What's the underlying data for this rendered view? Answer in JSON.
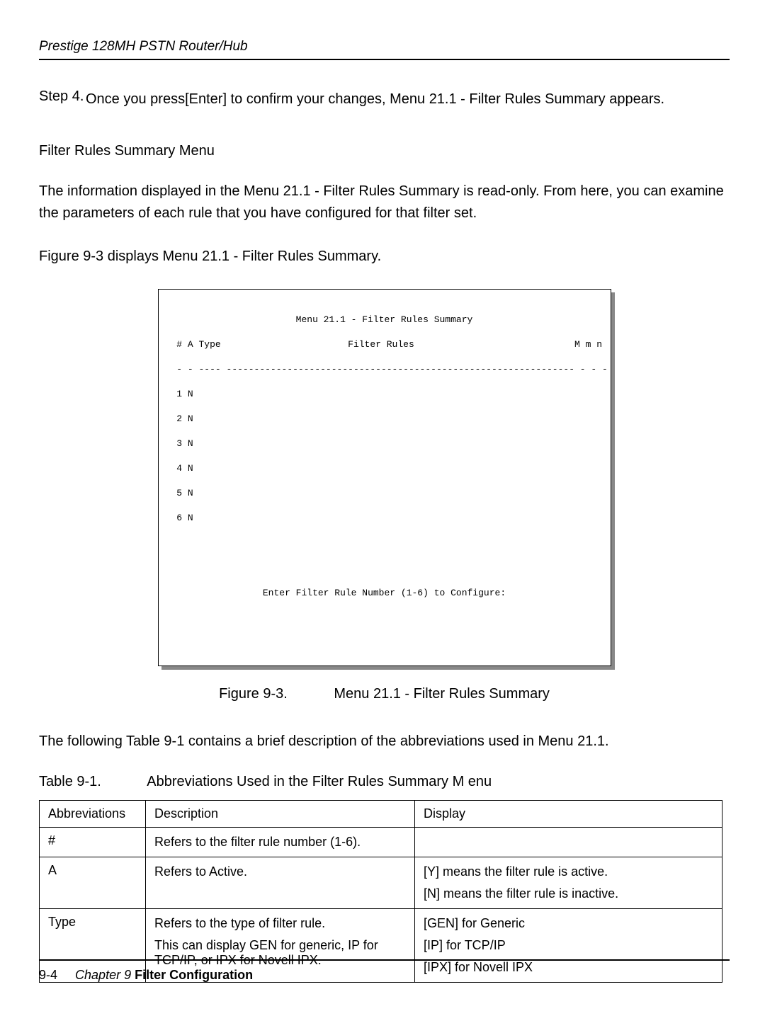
{
  "running_head": "Prestige 128MH   PSTN Router/Hub",
  "step": {
    "label": "Step 4.",
    "text_a": "Once you press",
    "text_b": "[Enter] to confirm your changes, Menu 21.1 - Filter Rules Summary appears."
  },
  "subhead": "Filter Rules Summary Menu",
  "para1": "The information displayed in the Menu 21.1 - Filter Rules Summary is read-only. From here, you can examine the parameters of each rule that you have configured for that filter set.",
  "para2": "Figure 9-3 displays Menu 21.1 - Filter Rules Summary.",
  "screen": {
    "title": "Menu 21.1 - Filter Rules Summary",
    "header": " # A Type                       Filter Rules                             M m n",
    "divider": " - - ---- --------------------------------------------------------------- - - -",
    "rows": [
      " 1 N",
      " 2 N",
      " 3 N",
      " 4 N",
      " 5 N",
      " 6 N"
    ],
    "prompt": "Enter Filter Rule Number (1-6) to Configure:"
  },
  "figure": {
    "label": "Figure  9-3.",
    "title": "Menu 21.1 - Filter Rules Summary"
  },
  "para3": "The following Table 9-1 contains a brief description of the abbreviations used in Menu 21.1.",
  "table": {
    "label": "Table 9-1.",
    "title": "Abbreviations Used in the Filter Rules Summary M      enu",
    "headers": [
      "Abbreviations",
      "Description",
      "Display"
    ],
    "rows": [
      {
        "abbr": "#",
        "desc": [
          "Refers to the filter rule number (1-6)."
        ],
        "disp": []
      },
      {
        "abbr": "A",
        "desc": [
          "Refers to Active."
        ],
        "disp": [
          "[Y] means the filter rule is active.",
          "[N] means the filter rule is inactive."
        ]
      },
      {
        "abbr": "Type",
        "desc": [
          "Refers to the type of filter rule.",
          "This can display GEN for generic, IP for TCP/IP, or IPX for Novell IPX."
        ],
        "disp": [
          "[GEN] for Generic",
          "[IP] for TCP/IP",
          "[IPX] for Novell IPX"
        ]
      }
    ]
  },
  "footer": {
    "page": "9-4",
    "chapter": "Chapter 9 ",
    "title": "Filter Configuration"
  }
}
